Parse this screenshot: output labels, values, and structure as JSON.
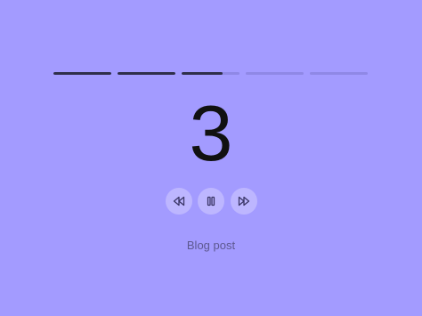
{
  "theme": {
    "background": "#a39bff",
    "text": "#111111",
    "segment_active": "#2f2f4a",
    "segment_track": "#8f88e6",
    "control_bg": "#bdb6ff",
    "icon_color": "#3a3566",
    "caption_color": "#5d5890"
  },
  "progress": {
    "segments": [
      {
        "fill": 1.0
      },
      {
        "fill": 1.0
      },
      {
        "fill": 0.7
      },
      {
        "fill": 0.0
      },
      {
        "fill": 0.0
      }
    ]
  },
  "countdown": {
    "value": "3"
  },
  "controls": {
    "rewind_icon": "rewind-icon",
    "pause_icon": "pause-icon",
    "forward_icon": "fast-forward-icon"
  },
  "caption": {
    "label": "Blog post"
  }
}
